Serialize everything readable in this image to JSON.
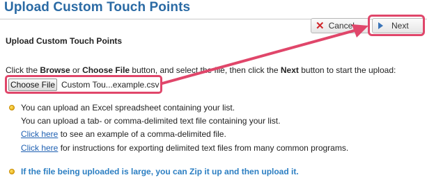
{
  "page": {
    "title": "Upload Custom Touch Points",
    "section_title": "Upload Custom Touch Points"
  },
  "toolbar": {
    "cancel_label": "Cancel",
    "next_label": "Next"
  },
  "instruction": {
    "part1": "Click the ",
    "browse": "Browse",
    "part2": " or ",
    "choose_file": "Choose File",
    "part3": " button, and select the file, then click the ",
    "next": "Next",
    "part4": " button to start the upload:"
  },
  "file_input": {
    "button_label": "Choose File",
    "file_name": "Custom Tou...example.csv"
  },
  "notes": {
    "excel": "You can upload an Excel spreadsheet containing your list.",
    "text": "You can upload a tab- or comma-delimited text file containing your list.",
    "example_link": "Click here",
    "example_rest": " to see an example of a comma-delimited file.",
    "instructions_link": "Click here",
    "instructions_rest": " for instructions for exporting delimited text files from many common programs.",
    "zip": "If the file being uploaded is large, you can Zip it up and then upload it."
  },
  "colors": {
    "title": "#2a6aa4",
    "highlight": "#e0466a",
    "link": "#1d5fb1",
    "zip_note": "#2b7ec2"
  }
}
